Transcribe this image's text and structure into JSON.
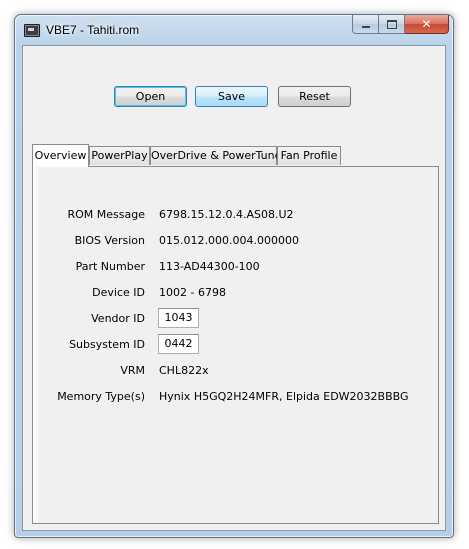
{
  "window": {
    "title": "VBE7 - Tahiti.rom"
  },
  "toolbar": {
    "open_label": "Open",
    "save_label": "Save",
    "reset_label": "Reset"
  },
  "tabs": [
    {
      "label": "Overview",
      "active": true
    },
    {
      "label": "PowerPlay",
      "active": false
    },
    {
      "label": "OverDrive & PowerTune",
      "active": false
    },
    {
      "label": "Fan Profile",
      "active": false
    }
  ],
  "overview": {
    "rom_message": {
      "label": "ROM Message",
      "value": "6798.15.12.0.4.AS08.U2"
    },
    "bios_version": {
      "label": "BIOS Version",
      "value": "015.012.000.004.000000"
    },
    "part_number": {
      "label": "Part Number",
      "value": "113-AD44300-100"
    },
    "device_id": {
      "label": "Device ID",
      "value": "1002 - 6798"
    },
    "vendor_id": {
      "label": "Vendor ID",
      "value": "1043"
    },
    "subsystem_id": {
      "label": "Subsystem ID",
      "value": "0442"
    },
    "vrm": {
      "label": "VRM",
      "value": "CHL822x"
    },
    "memory_type": {
      "label": "Memory Type(s)",
      "value": "Hynix H5GQ2H24MFR, Elpida EDW2032BBBG"
    }
  }
}
